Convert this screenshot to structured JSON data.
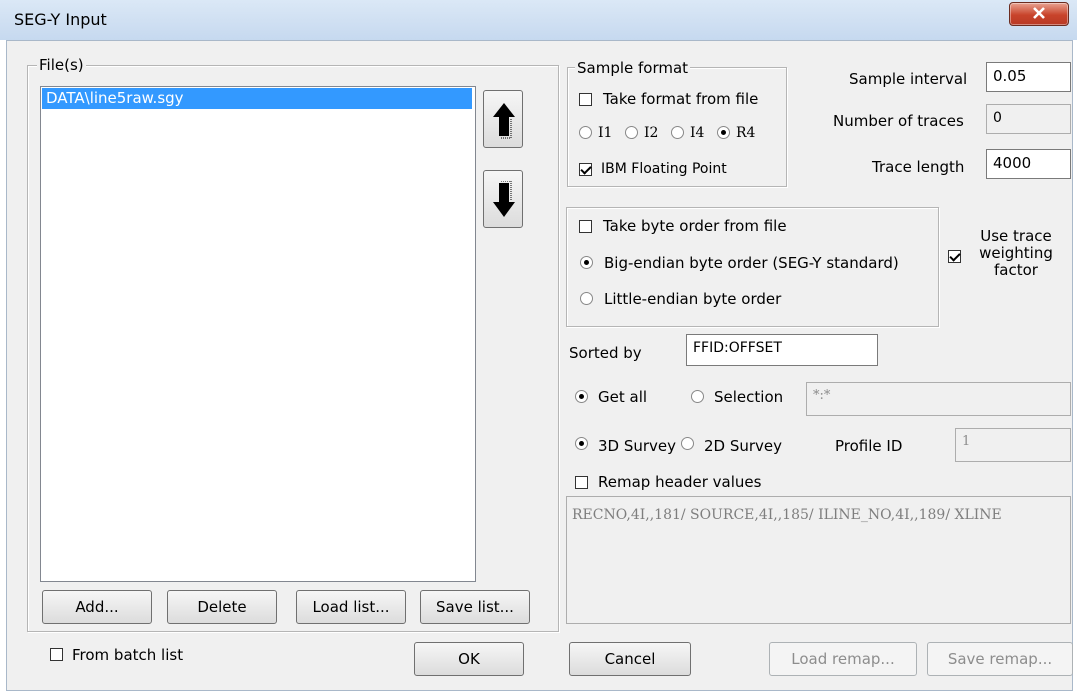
{
  "window": {
    "title": "SEG-Y Input"
  },
  "files": {
    "group_label": "File(s)",
    "items": [
      "DATA\\line5raw.sgy"
    ],
    "add_label": "Add...",
    "delete_label": "Delete",
    "load_list_label": "Load list...",
    "save_list_label": "Save list..."
  },
  "from_batch_list": {
    "label": "From batch list",
    "checked": false
  },
  "ok_label": "OK",
  "cancel_label": "Cancel",
  "sample_format": {
    "group_label": "Sample format",
    "take_from_file": {
      "label": "Take format from file",
      "checked": false
    },
    "formats": [
      {
        "label": "I1",
        "selected": false
      },
      {
        "label": "I2",
        "selected": false
      },
      {
        "label": "I4",
        "selected": false
      },
      {
        "label": "R4",
        "selected": true
      }
    ],
    "ibm_float": {
      "label": "IBM Floating Point",
      "checked": true
    }
  },
  "sample_interval": {
    "label": "Sample interval",
    "value": "0.05"
  },
  "number_of_traces": {
    "label": "Number of traces",
    "value": "0"
  },
  "trace_length": {
    "label": "Trace length",
    "value": "4000"
  },
  "byte_order": {
    "take_from_file": {
      "label": "Take byte order from file",
      "checked": false
    },
    "big_endian": {
      "label": "Big-endian byte order (SEG-Y standard)",
      "selected": true
    },
    "little_endian": {
      "label": "Little-endian byte order",
      "selected": false
    }
  },
  "trace_weighting": {
    "label": "Use trace weighting factor",
    "checked": true
  },
  "sorted_by": {
    "label": "Sorted by",
    "value": "FFID:OFFSET"
  },
  "get_all": {
    "label": "Get all",
    "selected": true
  },
  "selection": {
    "label": "Selection",
    "selected": false,
    "value": "*:*"
  },
  "survey_3d": {
    "label": "3D Survey",
    "selected": true
  },
  "survey_2d": {
    "label": "2D Survey",
    "selected": false
  },
  "profile_id": {
    "label": "Profile ID",
    "value": "1"
  },
  "remap": {
    "label": "Remap header values",
    "checked": false,
    "value": "RECNO,4I,,181/ SOURCE,4I,,185/ ILINE_NO,4I,,189/ XLINE",
    "load_label": "Load remap...",
    "save_label": "Save remap..."
  }
}
